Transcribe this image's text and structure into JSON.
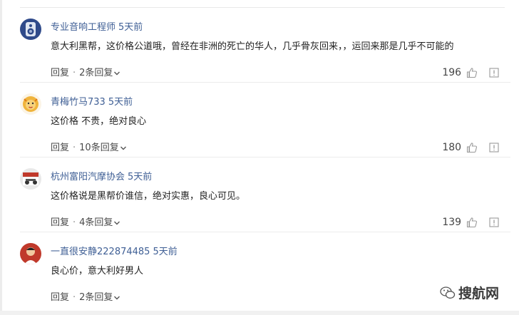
{
  "comments": [
    {
      "username": "专业音响工程师",
      "time": "5天前",
      "content": "意大利黑帮，这价格公道哦，曾经在非洲的死亡的华人，几乎骨灰回来，，运回来那是几乎不可能的",
      "reply_label": "回复",
      "dot": "·",
      "replies_label": "2条回复",
      "likes": "196",
      "avatar": "speaker-avatar"
    },
    {
      "username": "青梅竹马733",
      "time": "5天前",
      "content": "这价格 不贵，绝对良心",
      "reply_label": "回复",
      "dot": "·",
      "replies_label": "10条回复",
      "likes": "180",
      "avatar": "lion-avatar"
    },
    {
      "username": "杭州富阳汽摩协会",
      "time": "5天前",
      "content": "这价格说是黑帮价谁信，绝对实惠，良心可见。",
      "reply_label": "回复",
      "dot": "·",
      "replies_label": "4条回复",
      "likes": "139",
      "avatar": "club-avatar"
    },
    {
      "username": "一直很安静222874485",
      "time": "5天前",
      "content": "良心价，意大利好男人",
      "reply_label": "回复",
      "dot": "·",
      "replies_label": "2条回复",
      "likes": "",
      "avatar": "man-avatar"
    }
  ],
  "watermark": {
    "text": "搜航网",
    "icon": "wechat-icon"
  },
  "colors": {
    "username": "#3f5f95",
    "text": "#222222",
    "meta": "#4a4a4a"
  }
}
